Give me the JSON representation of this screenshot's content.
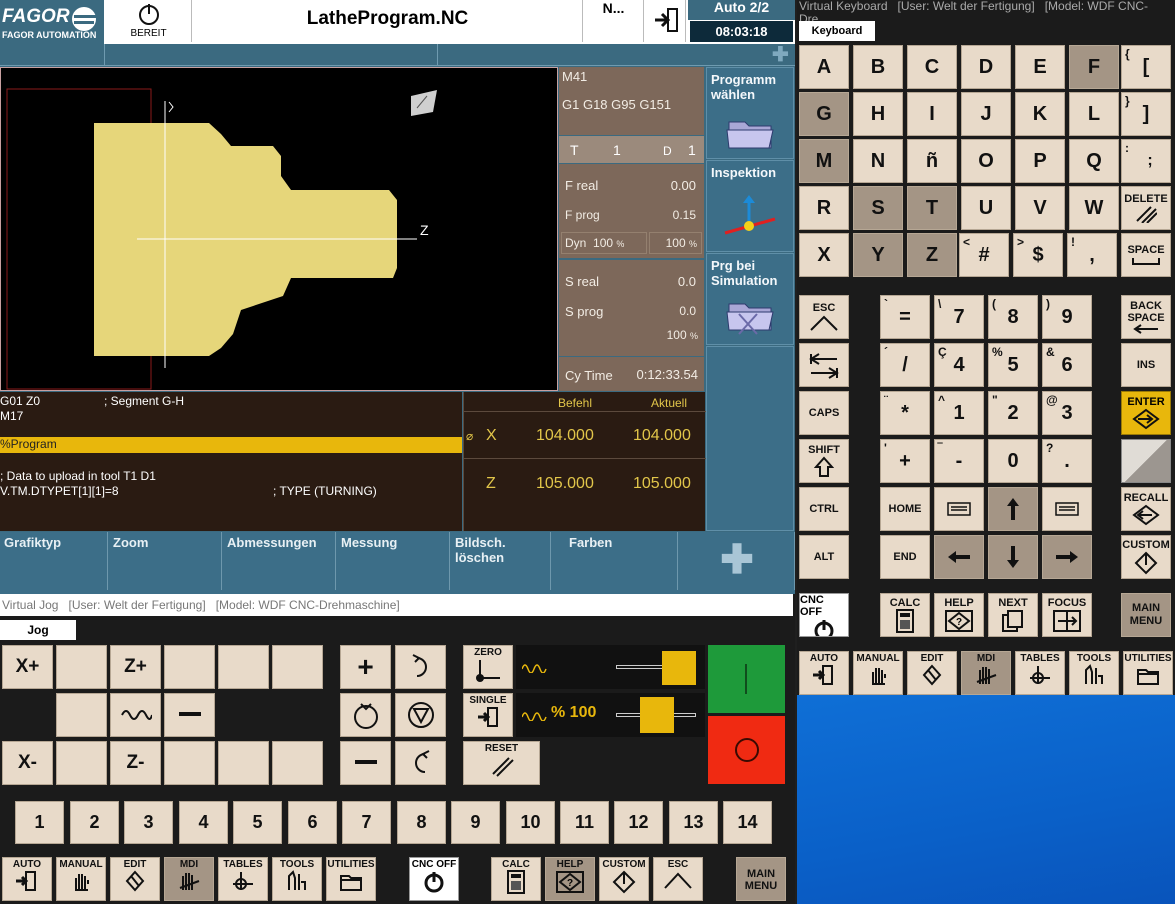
{
  "header": {
    "brand": "FAGOR",
    "brand_sub": "FAGOR AUTOMATION",
    "ready": "BEREIT",
    "program": "LatheProgram.NC",
    "mode_label": "N...",
    "auto": "Auto 2/2",
    "time": "08:03:18"
  },
  "status": {
    "m": "M41",
    "g": "G1 G18 G95 G151",
    "t_label": "T",
    "t_val": "1",
    "d_label": "D",
    "d_val": "1",
    "freal_label": "F real",
    "freal": "0.00",
    "fprog_label": "F prog",
    "fprog": "0.15",
    "dyn_label": "Dyn",
    "dyn1": "100",
    "dyn2": "100",
    "pct": "%",
    "sreal_label": "S real",
    "sreal": "0.0",
    "sprog_label": "S prog",
    "sprog": "0.0",
    "spct": "100",
    "cytime_label": "Cy Time",
    "cytime": "0:12:33.54"
  },
  "side": {
    "prog": "Programm wählen",
    "insp": "Inspektion",
    "sim": "Prg bei Simulation"
  },
  "graph": {
    "axis_z": "Z",
    "axis_x": "X"
  },
  "code": {
    "l1": "G01 Z0",
    "l1c": "; Segment G-H",
    "l2": "M17",
    "l3": "%Program",
    "l4": "; Data to upload in tool T1 D1",
    "l5": "V.TM.DTYPET[1][1]=8",
    "l5c": "; TYPE (TURNING)"
  },
  "coords": {
    "befehl": "Befehl",
    "aktuell": "Aktuell",
    "x": "X",
    "z": "Z",
    "x_cmd": "104.000",
    "x_act": "104.000",
    "z_cmd": "105.000",
    "z_act": "105.000"
  },
  "ftabs": [
    "Grafiktyp",
    "Zoom",
    "Abmessungen",
    "Messung",
    "Bildsch. löschen",
    "Farben"
  ],
  "jog": {
    "title": "Virtual Jog",
    "user": "[User: Welt der Fertigung]",
    "model": "[Model: WDF CNC-Drehmaschine]",
    "tab": "Jog",
    "xp": "X+",
    "zp": "Z+",
    "xm": "X-",
    "zm": "Z-",
    "zero": "ZERO",
    "single": "SINGLE",
    "reset": "RESET",
    "ovr": "% 100",
    "nums": [
      "1",
      "2",
      "3",
      "4",
      "5",
      "6",
      "7",
      "8",
      "9",
      "10",
      "11",
      "12",
      "13",
      "14"
    ],
    "bottom": [
      "AUTO",
      "MANUAL",
      "EDIT",
      "MDI",
      "TABLES",
      "TOOLS",
      "UTILITIES"
    ],
    "cncoff": "CNC OFF",
    "calc": "CALC",
    "help": "HELP",
    "custom": "CUSTOM",
    "esc": "ESC",
    "main": "MAIN MENU"
  },
  "kb": {
    "title": "Virtual Keyboard",
    "user": "[User: Welt der Fertigung]",
    "model": "[Model: WDF CNC-Dre...",
    "tab": "Keyboard",
    "letters": [
      "A",
      "B",
      "C",
      "D",
      "E",
      "F",
      "G",
      "H",
      "I",
      "J",
      "K",
      "L",
      "M",
      "N",
      "ñ",
      "O",
      "P",
      "Q",
      "R",
      "S",
      "T",
      "U",
      "V",
      "W",
      "X",
      "Y",
      "Z"
    ],
    "b1": "[",
    "b1s": "{",
    "b2": "]",
    "b2s": "}",
    "semi": ";",
    "semis": ":",
    "delete": "DELETE",
    "hash": "#",
    "hashs": "<",
    "dollar": "$",
    "dollars": ">",
    "comma": ",",
    "commas": "!",
    "space": "SPACE",
    "esc": "ESC",
    "backspace": "BACK SPACE",
    "ins": "INS",
    "caps": "CAPS",
    "enter": "ENTER",
    "shift": "SHIFT",
    "ctrl": "CTRL",
    "home": "HOME",
    "recall": "RECALL",
    "alt": "ALT",
    "end": "END",
    "custom": "CUSTOM",
    "cncoff": "CNC OFF",
    "calc": "CALC",
    "help": "HELP",
    "next": "NEXT",
    "focus": "FOCUS",
    "main": "MAIN MENU",
    "n7": "7",
    "n7s": "\\",
    "n8": "8",
    "n8s": "(",
    "n9": "9",
    "n9s": ")",
    "eq": "=",
    "eqs": "`",
    "n4": "4",
    "n4s": "Ç",
    "n5": "5",
    "n5s": "%",
    "n6": "6",
    "n6s": "&",
    "sl": "/",
    "sls": "´",
    "n1": "1",
    "n1s": "^",
    "n2": "2",
    "n2s": "\"",
    "n3": "3",
    "n3s": "@",
    "st": "*",
    "sts": "¨",
    "pl": "+",
    "pls": "'",
    "mi": "-",
    "mis": "‾",
    "n0": "0",
    "dot": ".",
    "dots": "?",
    "bottom": [
      "AUTO",
      "MANUAL",
      "EDIT",
      "MDI",
      "TABLES",
      "TOOLS",
      "UTILITIES"
    ]
  }
}
